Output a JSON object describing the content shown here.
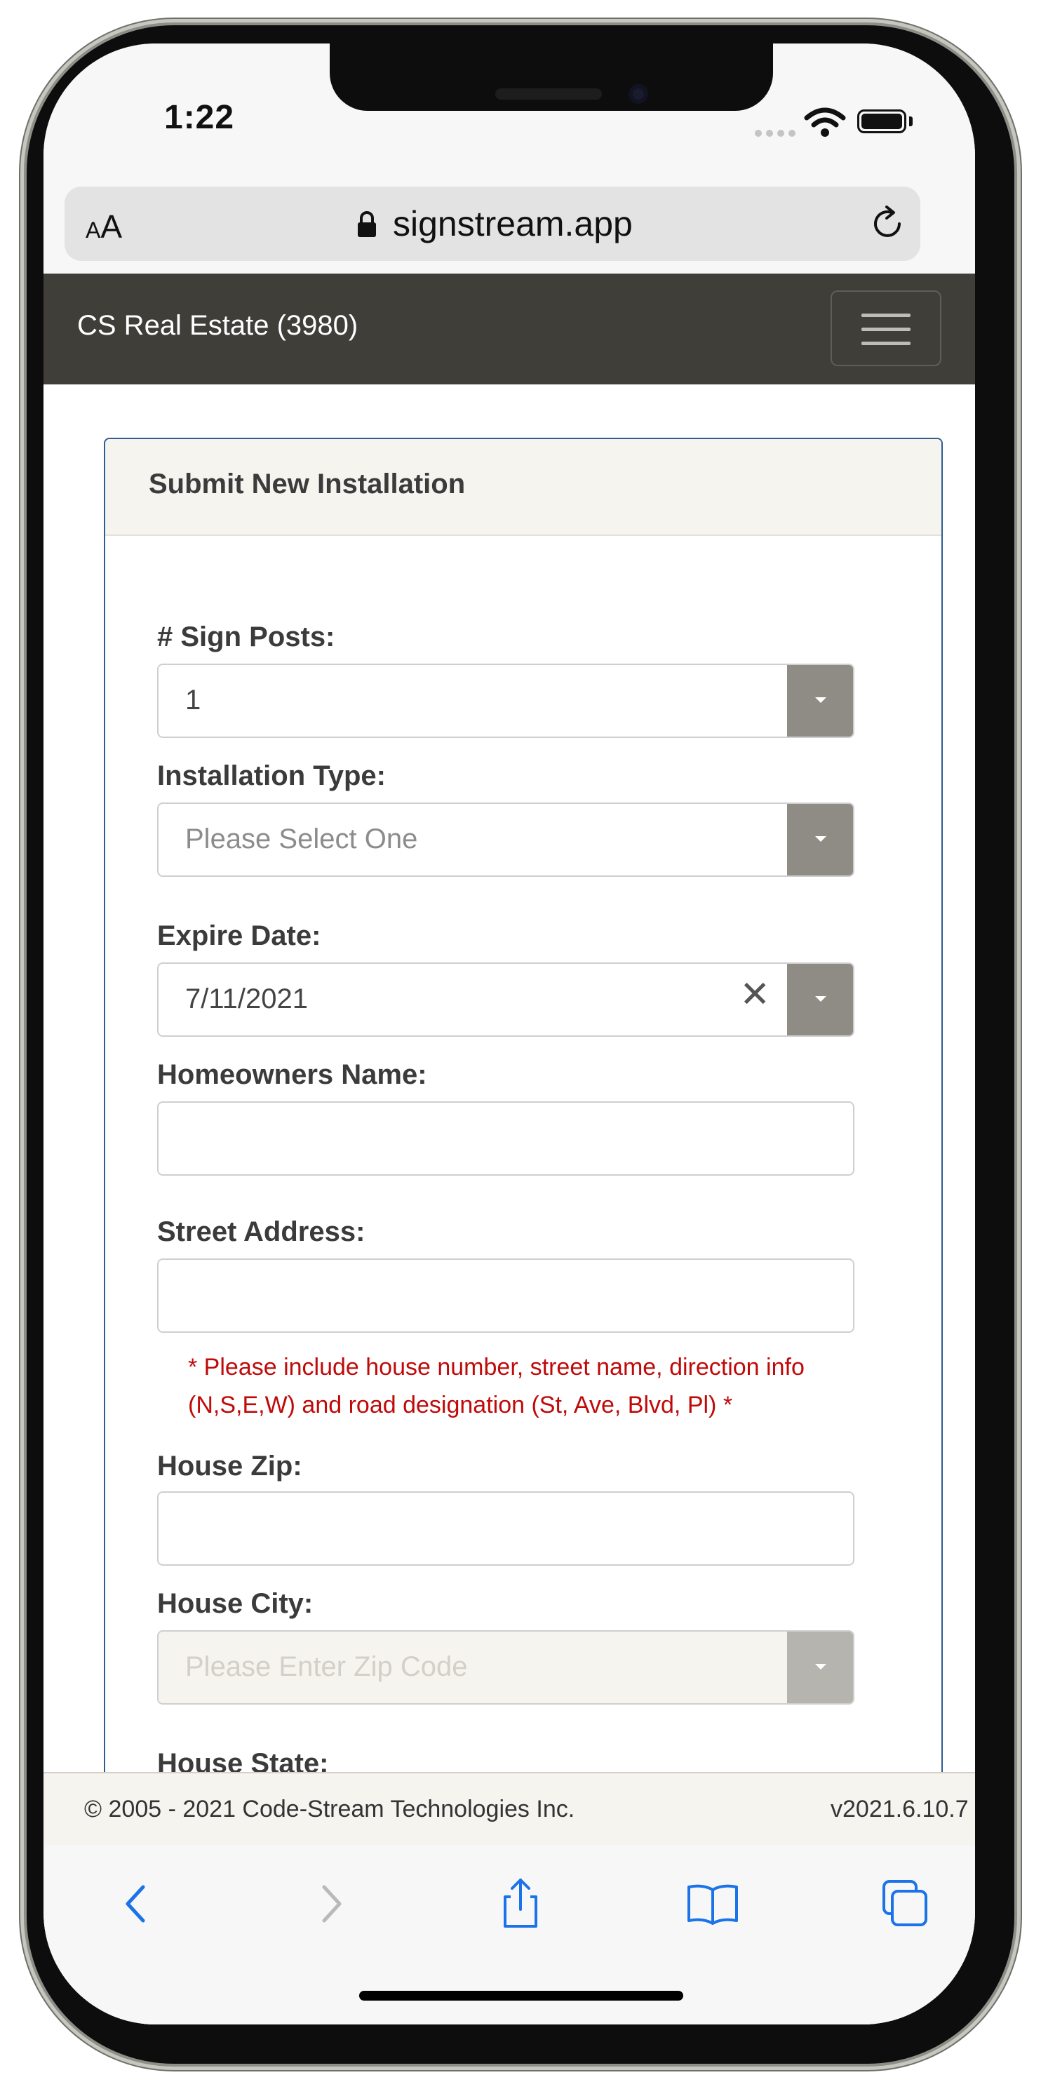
{
  "status_bar": {
    "time": "1:22"
  },
  "browser": {
    "text_size_small": "A",
    "text_size_large": "A",
    "url": "signstream.app"
  },
  "navbar": {
    "brand": "CS Real Estate (3980)"
  },
  "form": {
    "title": "Submit New Installation",
    "sign_posts": {
      "label": "# Sign Posts:",
      "value": "1"
    },
    "installation_type": {
      "label": "Installation Type:",
      "placeholder": "Please Select One"
    },
    "expire_date": {
      "label": "Expire Date:",
      "value": "7/11/2021",
      "clear": "✕"
    },
    "homeowners_name": {
      "label": "Homeowners Name:",
      "value": ""
    },
    "street_address": {
      "label": "Street Address:",
      "value": "",
      "hint": "* Please include house number, street name, direction info (N,S,E,W) and road designation (St, Ave, Blvd, Pl) *"
    },
    "house_zip": {
      "label": "House Zip:",
      "value": ""
    },
    "house_city": {
      "label": "House City:",
      "placeholder": "Please Enter Zip Code"
    },
    "house_state": {
      "label": "House State:"
    }
  },
  "footer": {
    "copyright": "© 2005 - 2021 Code-Stream Technologies Inc.",
    "version": "v2021.6.10.7"
  },
  "colors": {
    "navbar": "#3f3e39",
    "card_border": "#2f5d92",
    "dropdown_button": "#8f8c85",
    "hint_text": "#c00a0a",
    "ios_blue": "#1a73e8"
  },
  "icons": {
    "secure": "lock-icon",
    "reload": "reload-icon",
    "menu": "hamburger-icon",
    "back": "chevron-left-icon",
    "forward": "chevron-right-icon",
    "share": "share-icon",
    "bookmarks": "book-icon",
    "tabs": "tabs-icon"
  }
}
